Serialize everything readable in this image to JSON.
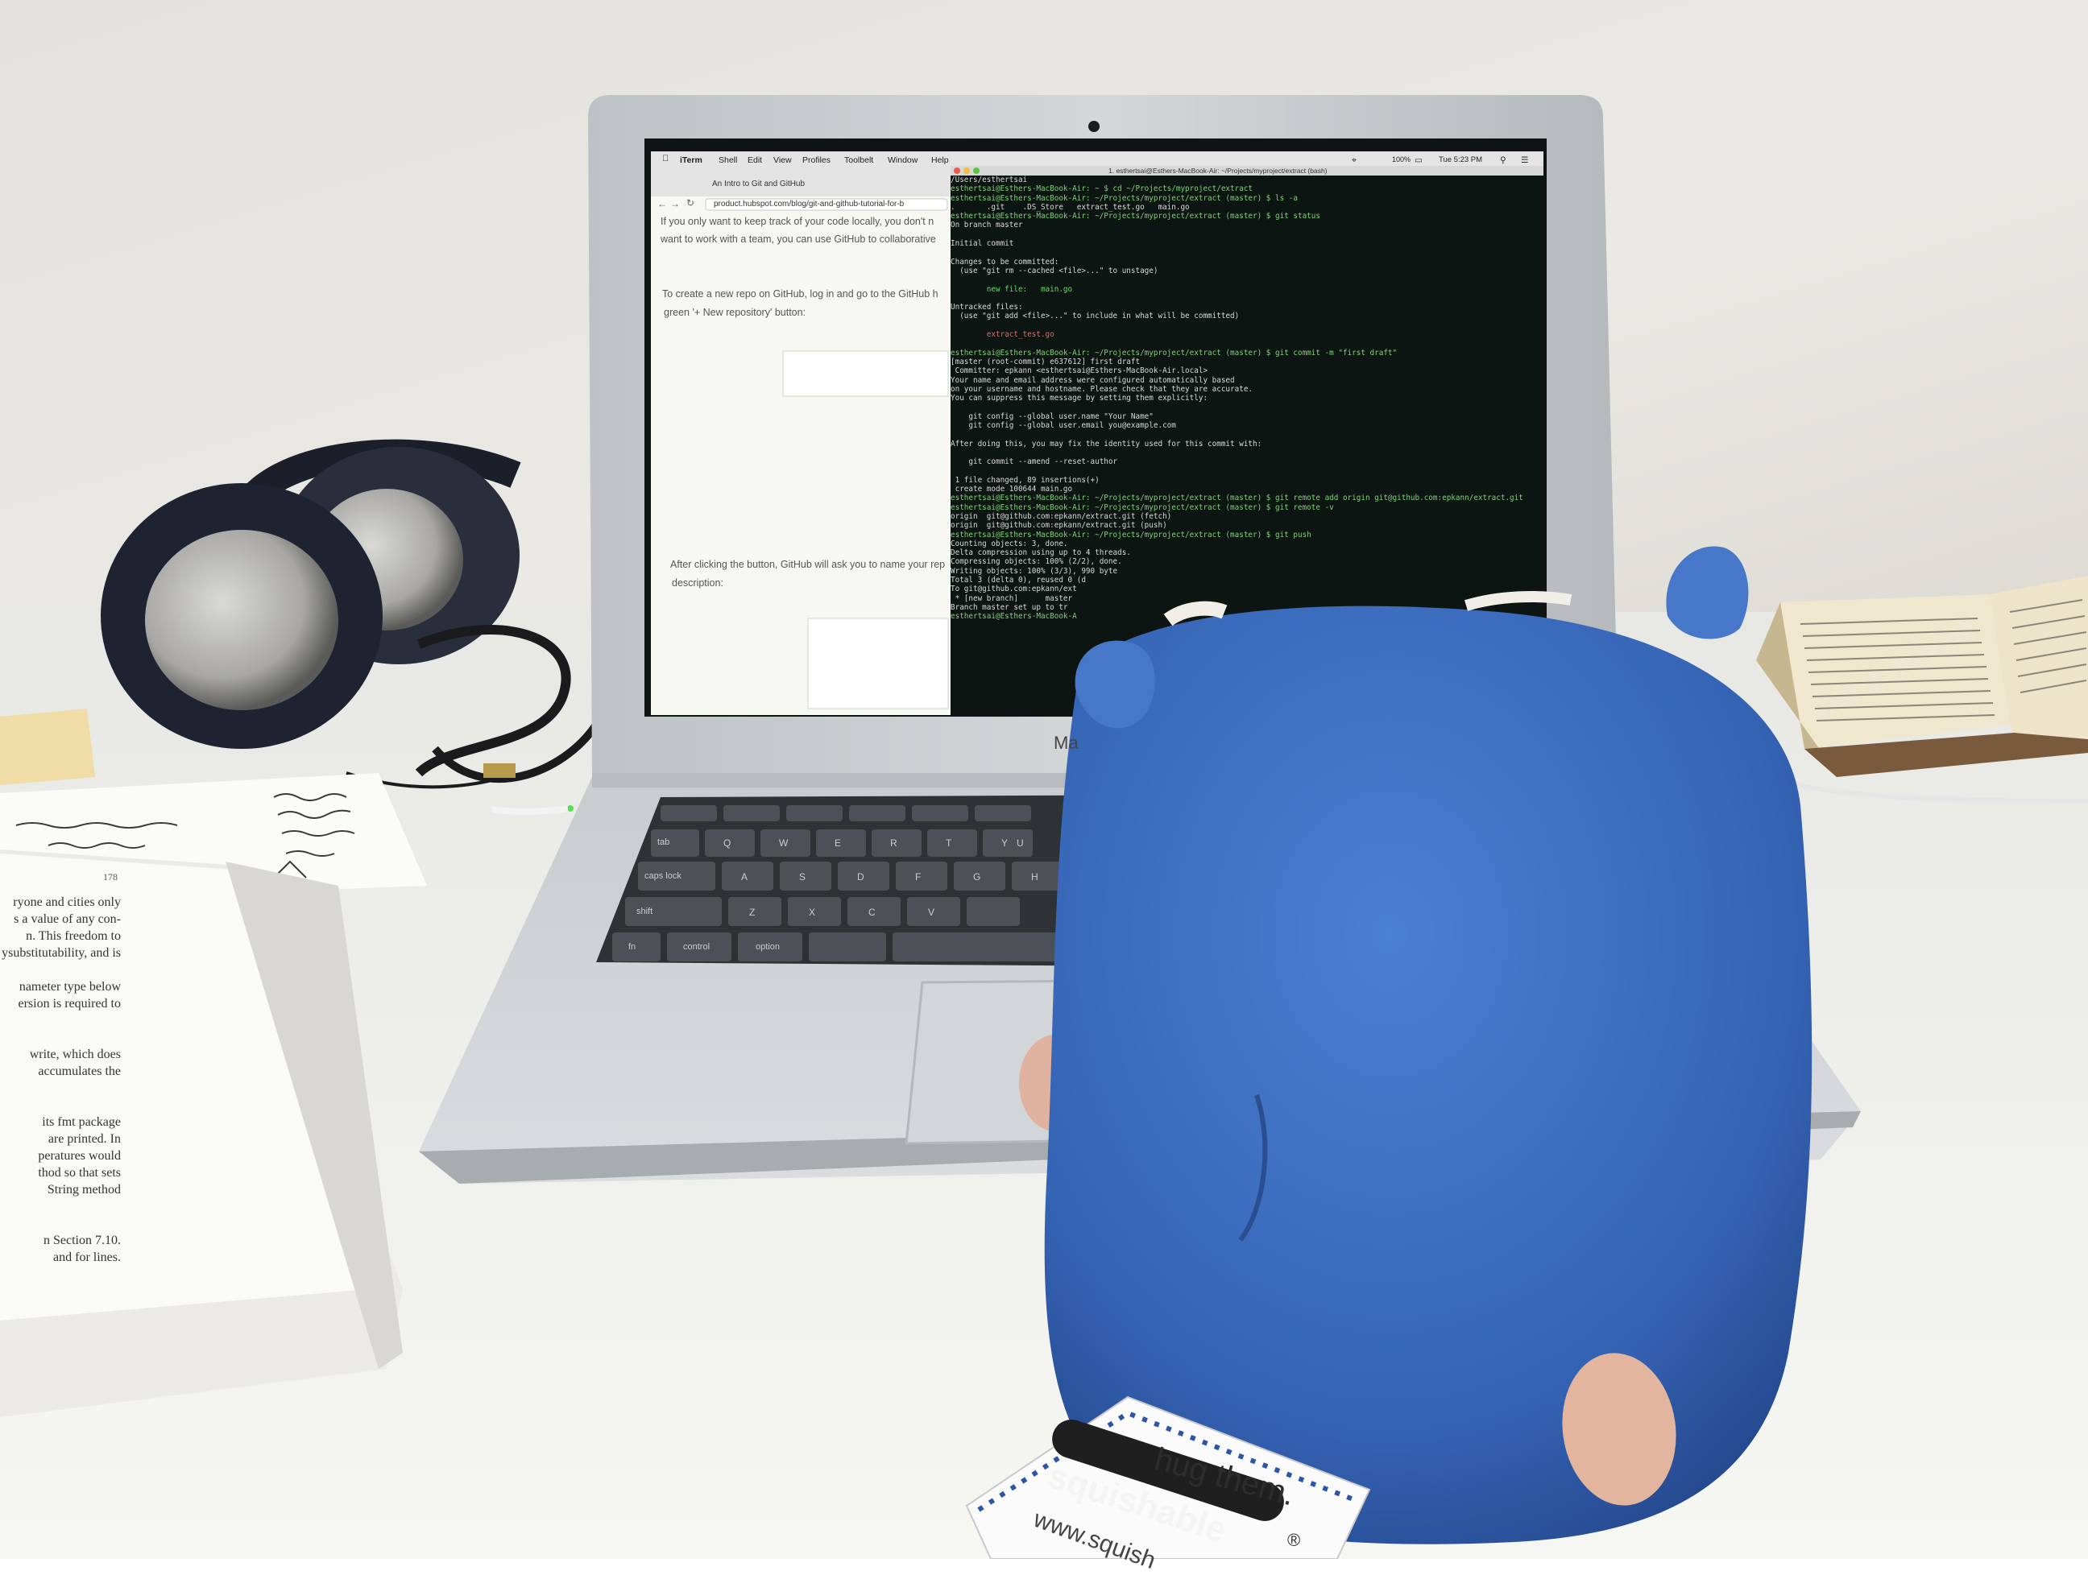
{
  "menubar": {
    "app": "iTerm",
    "items": [
      "Shell",
      "Edit",
      "View",
      "Profiles",
      "Toolbelt",
      "Window",
      "Help"
    ],
    "clock": "Tue 5:23 PM",
    "battery": "100%"
  },
  "browser": {
    "tab_title": "An Intro to Git and GitHub",
    "url": "product.hubspot.com/blog/git-and-github-tutorial-for-b",
    "para1_line1": "If you only want to keep track of your code locally, you don't n",
    "para1_line2": "want to work with a team, you can use GitHub to collaborative",
    "para2_line1": "To create a new repo on GitHub, log in and go to the GitHub h",
    "para2_line2": "green '+ New repository' button:",
    "para3_line1": "After clicking the button, GitHub will ask you to name your rep",
    "para3_line2": "description:"
  },
  "terminal": {
    "title": "1. esthertsai@Esthers-MacBook-Air: ~/Projects/myproject/extract (bash)",
    "lines": [
      {
        "t": "/Users/esthertsai",
        "c": ""
      },
      {
        "t": "esthertsai@Esthers-MacBook-Air: ~ $ cd ~/Projects/myproject/extract",
        "c": "prompt"
      },
      {
        "t": "esthertsai@Esthers-MacBook-Air: ~/Projects/myproject/extract (master) $ ls -a",
        "c": "prompt"
      },
      {
        "t": ".       .git    .DS_Store   extract_test.go   main.go",
        "c": ""
      },
      {
        "t": "esthertsai@Esthers-MacBook-Air: ~/Projects/myproject/extract (master) $ git status",
        "c": "prompt"
      },
      {
        "t": "On branch master",
        "c": ""
      },
      {
        "t": "",
        "c": ""
      },
      {
        "t": "Initial commit",
        "c": ""
      },
      {
        "t": "",
        "c": ""
      },
      {
        "t": "Changes to be committed:",
        "c": ""
      },
      {
        "t": "  (use \"git rm --cached <file>...\" to unstage)",
        "c": ""
      },
      {
        "t": "",
        "c": ""
      },
      {
        "t": "        new file:   main.go",
        "c": "green"
      },
      {
        "t": "",
        "c": ""
      },
      {
        "t": "Untracked files:",
        "c": ""
      },
      {
        "t": "  (use \"git add <file>...\" to include in what will be committed)",
        "c": ""
      },
      {
        "t": "",
        "c": ""
      },
      {
        "t": "        extract_test.go",
        "c": "red"
      },
      {
        "t": "",
        "c": ""
      },
      {
        "t": "esthertsai@Esthers-MacBook-Air: ~/Projects/myproject/extract (master) $ git commit -m \"first draft\"",
        "c": "prompt"
      },
      {
        "t": "[master (root-commit) e637612] first draft",
        "c": ""
      },
      {
        "t": " Committer: epkann <esthertsai@Esthers-MacBook-Air.local>",
        "c": ""
      },
      {
        "t": "Your name and email address were configured automatically based",
        "c": ""
      },
      {
        "t": "on your username and hostname. Please check that they are accurate.",
        "c": ""
      },
      {
        "t": "You can suppress this message by setting them explicitly:",
        "c": ""
      },
      {
        "t": "",
        "c": ""
      },
      {
        "t": "    git config --global user.name \"Your Name\"",
        "c": ""
      },
      {
        "t": "    git config --global user.email you@example.com",
        "c": ""
      },
      {
        "t": "",
        "c": ""
      },
      {
        "t": "After doing this, you may fix the identity used for this commit with:",
        "c": ""
      },
      {
        "t": "",
        "c": ""
      },
      {
        "t": "    git commit --amend --reset-author",
        "c": ""
      },
      {
        "t": "",
        "c": ""
      },
      {
        "t": " 1 file changed, 89 insertions(+)",
        "c": ""
      },
      {
        "t": " create mode 100644 main.go",
        "c": ""
      },
      {
        "t": "esthertsai@Esthers-MacBook-Air: ~/Projects/myproject/extract (master) $ git remote add origin git@github.com:epkann/extract.git",
        "c": "prompt"
      },
      {
        "t": "esthertsai@Esthers-MacBook-Air: ~/Projects/myproject/extract (master) $ git remote -v",
        "c": "prompt"
      },
      {
        "t": "origin  git@github.com:epkann/extract.git (fetch)",
        "c": ""
      },
      {
        "t": "origin  git@github.com:epkann/extract.git (push)",
        "c": ""
      },
      {
        "t": "esthertsai@Esthers-MacBook-Air: ~/Projects/myproject/extract (master) $ git push",
        "c": "prompt"
      },
      {
        "t": "Counting objects: 3, done.",
        "c": ""
      },
      {
        "t": "Delta compression using up to 4 threads.",
        "c": ""
      },
      {
        "t": "Compressing objects: 100% (2/2), done.",
        "c": ""
      },
      {
        "t": "Writing objects: 100% (3/3), 990 byte",
        "c": ""
      },
      {
        "t": "Total 3 (delta 0), reused 0 (d",
        "c": ""
      },
      {
        "t": "To git@github.com:epkann/ext",
        "c": ""
      },
      {
        "t": " * [new branch]      master",
        "c": ""
      },
      {
        "t": "Branch master set up to tr",
        "c": ""
      },
      {
        "t": "esthertsai@Esthers-MacBook-A",
        "c": "prompt"
      }
    ]
  },
  "laptop_label": "Ma",
  "keyboard": {
    "tab": "tab",
    "caps": "caps lock",
    "shift": "shift",
    "fn": "fn",
    "control": "control",
    "option": "option",
    "row1": [
      "Q",
      "W",
      "E",
      "R",
      "T",
      "Y",
      "U"
    ],
    "row2": [
      "A",
      "S",
      "D",
      "F",
      "G",
      "H"
    ],
    "row3": [
      "Z",
      "X",
      "C",
      "V"
    ]
  },
  "tag": {
    "line1": "hug them.",
    "brand": "squishable",
    "url": "www.squish",
    "reg": "®"
  },
  "book_left": {
    "page_no": "178",
    "lines": [
      "ryone and cities only",
      "s a value of any con-",
      "n. This freedom to",
      "ysubstitutability, and is",
      "",
      "nameter type below",
      "ersion is required to",
      "",
      "",
      "write, which does",
      "accumulates the",
      "",
      "",
      "its fmt package",
      "are printed. In",
      "peratures would",
      "thod so that sets",
      "String method",
      "",
      "",
      "n Section 7.10.",
      "and for lines."
    ]
  },
  "colors": {
    "wall": "#e9e6df",
    "desk": "#f1f0ec",
    "laptop": "#c9cbcd",
    "terminal_bg": "#0d1512",
    "gopher": "#3d6fc2",
    "gopher_dark": "#24498e",
    "nose": "#e3b59e"
  },
  "icons": [
    "apple-icon",
    "wifi-icon",
    "battery-icon",
    "search-icon",
    "spotlight-icon",
    "camera-icon"
  ]
}
